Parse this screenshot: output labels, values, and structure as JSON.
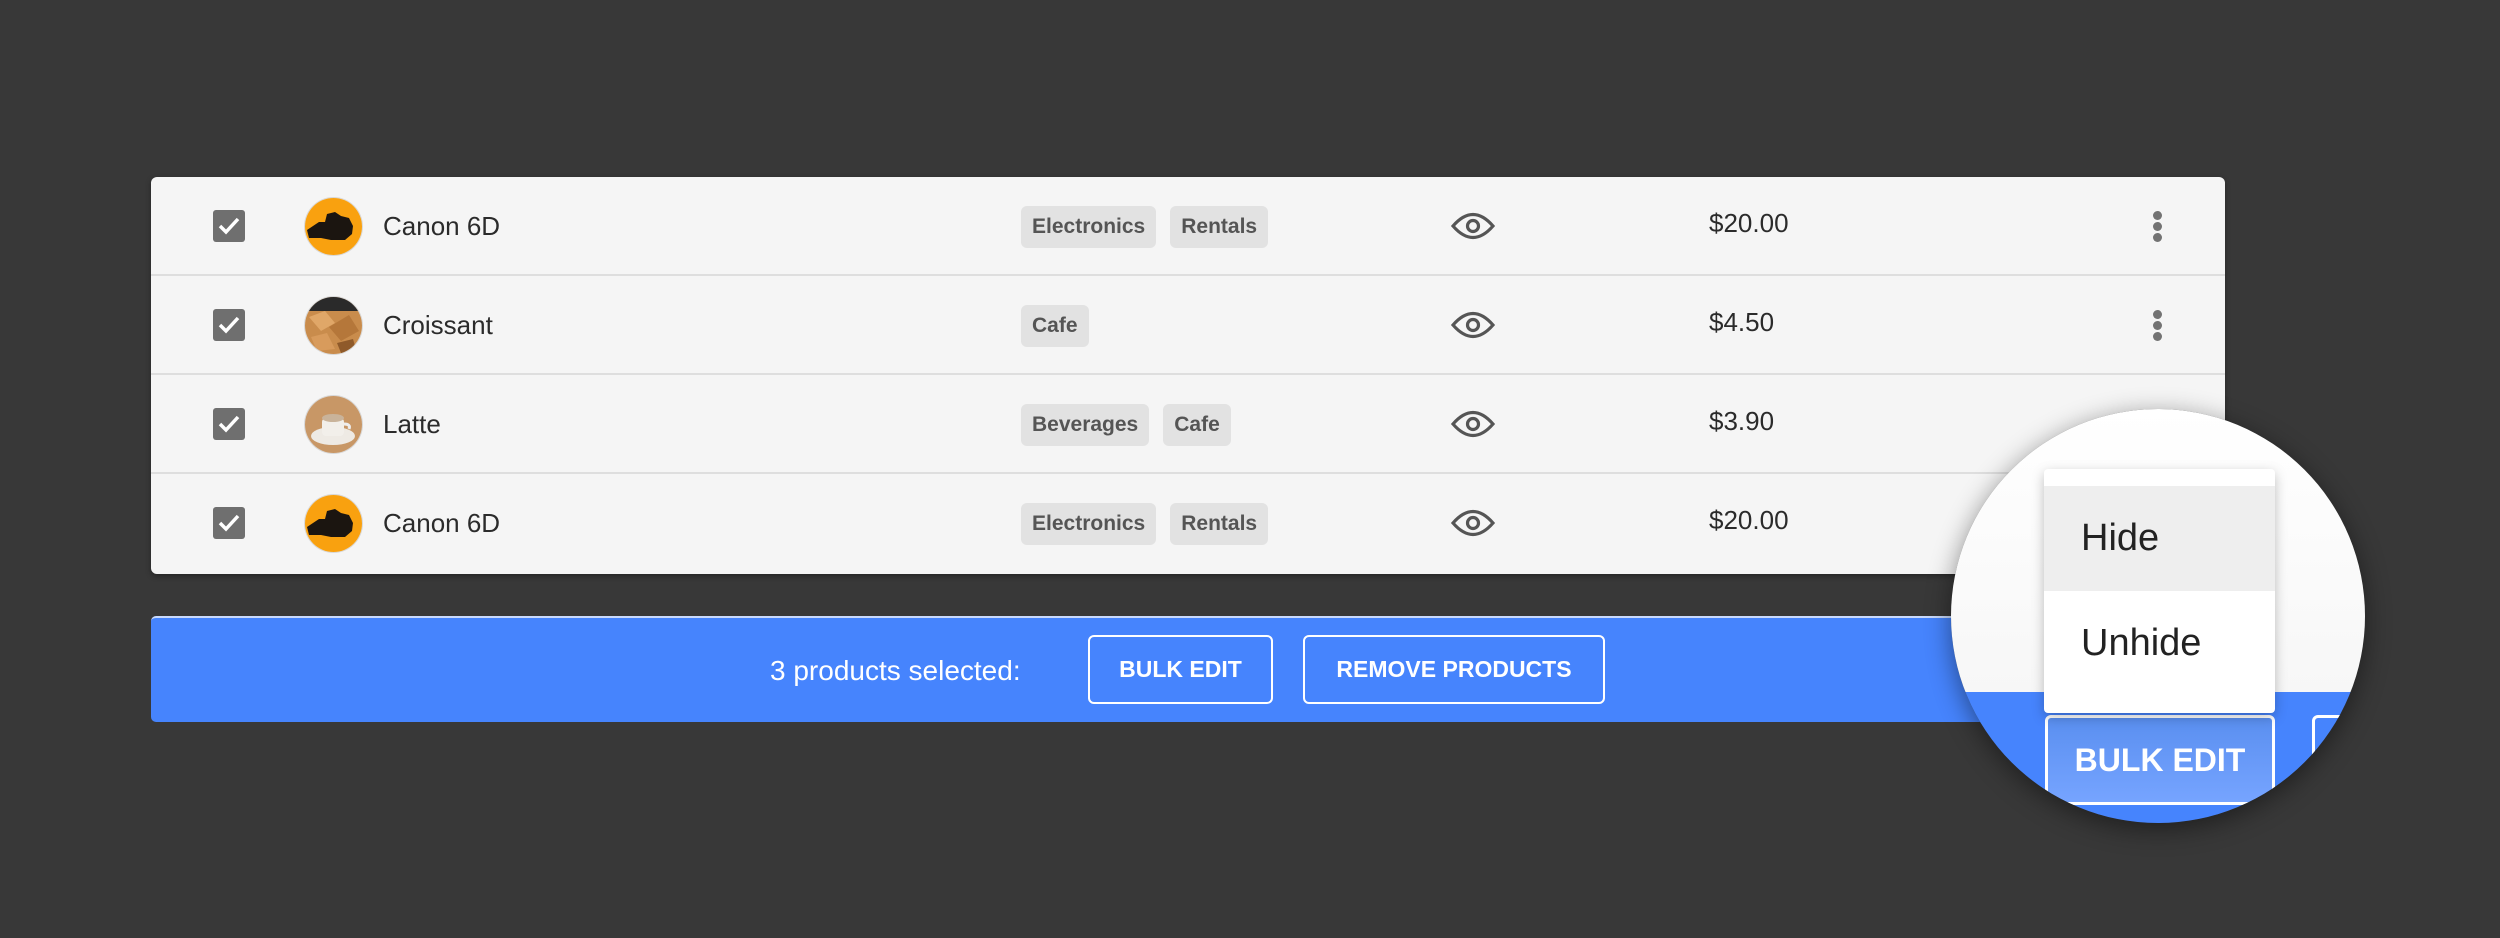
{
  "products": [
    {
      "name": "Canon 6D",
      "checked": true,
      "avatar": "camera",
      "tags": [
        "Electronics",
        "Rentals"
      ],
      "visibility_icon": "eye-icon",
      "price": "$20.00",
      "has_menu": true
    },
    {
      "name": "Croissant",
      "checked": true,
      "avatar": "croissant",
      "tags": [
        "Cafe"
      ],
      "visibility_icon": "eye-icon",
      "price": "$4.50",
      "has_menu": true
    },
    {
      "name": "Latte",
      "checked": true,
      "avatar": "latte",
      "tags": [
        "Beverages",
        "Cafe"
      ],
      "visibility_icon": "eye-icon",
      "price": "$3.90",
      "has_menu": true
    },
    {
      "name": "Canon 6D",
      "checked": true,
      "avatar": "camera",
      "tags": [
        "Electronics",
        "Rentals"
      ],
      "visibility_icon": "eye-icon",
      "price": "$20.00",
      "has_menu": true
    }
  ],
  "bulk_bar": {
    "selected_text": "3 products selected:",
    "bulk_edit_label": "BULK EDIT",
    "remove_label": "REMOVE PRODUCTS"
  },
  "magnifier": {
    "menu_items": [
      {
        "label": "Hide",
        "highlighted": true
      },
      {
        "label": "Unhide",
        "highlighted": false
      }
    ],
    "button_label": "BULK EDIT"
  },
  "colors": {
    "background": "#383838",
    "table_bg": "#f5f5f5",
    "accent_blue": "#4684fd",
    "tag_bg": "#e2e2e2",
    "checkbox": "#6f6f6f",
    "camera_avatar": "#f9a10f"
  }
}
